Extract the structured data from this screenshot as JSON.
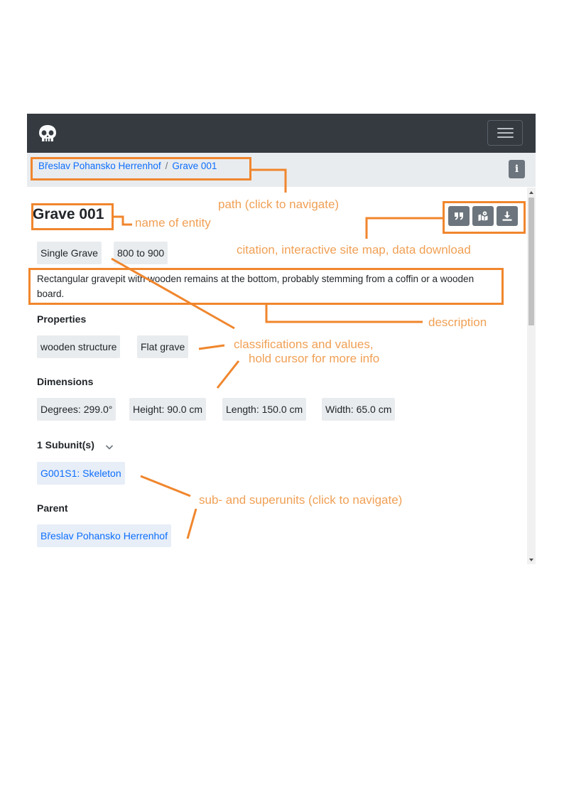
{
  "breadcrumb": {
    "items": [
      "Břeslav Pohansko Herrenhof",
      "Grave 001"
    ],
    "separator": "/"
  },
  "info_button_label": "i",
  "entity": {
    "title": "Grave 001",
    "type": "Single Grave",
    "date_range": "800 to 900",
    "description": "Rectangular gravepit with wooden remains at the bottom, probably stemming from a coffin or a wooden board."
  },
  "toolbar": {
    "buttons": [
      "quote-icon",
      "map-icon",
      "download-icon"
    ]
  },
  "properties": {
    "heading": "Properties",
    "items": [
      "wooden structure",
      "Flat grave"
    ]
  },
  "dimensions": {
    "heading": "Dimensions",
    "items": [
      "Degrees: 299.0°",
      "Height: 90.0 cm",
      "Length: 150.0 cm",
      "Width: 65.0 cm"
    ]
  },
  "subunits": {
    "heading": "1 Subunit(s)",
    "items": [
      "G001S1: Skeleton"
    ]
  },
  "parent": {
    "heading": "Parent",
    "items": [
      "Břeslav Pohansko Herrenhof"
    ]
  },
  "annotations": {
    "path": "path (click to navigate)",
    "name": "name of entity",
    "tools": "citation, interactive site map, data download",
    "description": "description",
    "classifications_1": "classifications and values,",
    "classifications_2": "hold cursor for more info",
    "units": "sub- and superunits (click to navigate)"
  },
  "colors": {
    "navbar": "#343a40",
    "breadcrumb_bar": "#e9ecef",
    "link": "#0d6efd",
    "annotation": "#f0862d",
    "annotation_text": "#f0a055",
    "button": "#6c757d"
  }
}
